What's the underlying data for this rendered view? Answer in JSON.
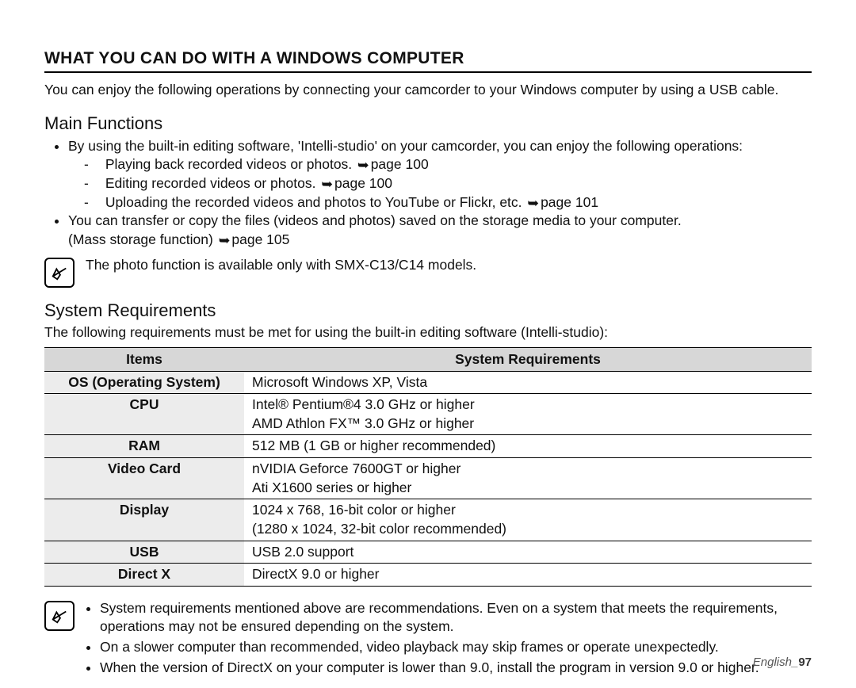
{
  "title": "WHAT YOU CAN DO WITH A WINDOWS COMPUTER",
  "intro": "You can enjoy the following operations by connecting your camcorder to your Windows computer by using a USB cable.",
  "main_functions": {
    "heading": "Main Functions",
    "bullet1": "By using the built-in editing software, 'Intelli-studio' on your camcorder, you can enjoy the following operations:",
    "sub1": "Playing back recorded videos or photos. ",
    "sub1_ref": "page 100",
    "sub2": "Editing recorded videos or photos. ",
    "sub2_ref": "page 100",
    "sub3": "Uploading the recorded videos and photos to YouTube or Flickr, etc. ",
    "sub3_ref": "page 101",
    "bullet2a": "You can transfer or copy the files (videos and photos) saved on the storage media to your computer.",
    "bullet2b": "(Mass storage function) ",
    "bullet2_ref": "page 105",
    "note": "The photo function is available only with SMX-C13/C14 models."
  },
  "system_requirements": {
    "heading": "System Requirements",
    "intro": "The following requirements must be met for using the built-in editing software (Intelli-studio):",
    "col1": "Items",
    "col2": "System Requirements",
    "rows": [
      {
        "item": "OS (Operating System)",
        "value": "Microsoft Windows XP, Vista"
      },
      {
        "item": "CPU",
        "value": "Intel® Pentium®4 3.0 GHz or higher\nAMD Athlon FX™ 3.0 GHz or higher"
      },
      {
        "item": "RAM",
        "value": "512 MB (1 GB or higher recommended)"
      },
      {
        "item": "Video Card",
        "value": "nVIDIA Geforce 7600GT or higher\nAti X1600 series or higher"
      },
      {
        "item": "Display",
        "value": "1024 x 768, 16-bit color or higher\n(1280 x 1024, 32-bit color recommended)"
      },
      {
        "item": "USB",
        "value": "USB 2.0 support"
      },
      {
        "item": "Direct X",
        "value": "DirectX 9.0 or higher"
      }
    ]
  },
  "footer_notes": [
    "System requirements mentioned above are recommendations. Even on a system that meets the requirements, operations may not be ensured depending on the system.",
    "On a slower computer than recommended, video playback may skip frames or operate unexpectedly.",
    "When the version of DirectX on your computer is lower than 9.0, install the program in version 9.0 or higher."
  ],
  "footer": {
    "lang": "English",
    "page": "97"
  }
}
